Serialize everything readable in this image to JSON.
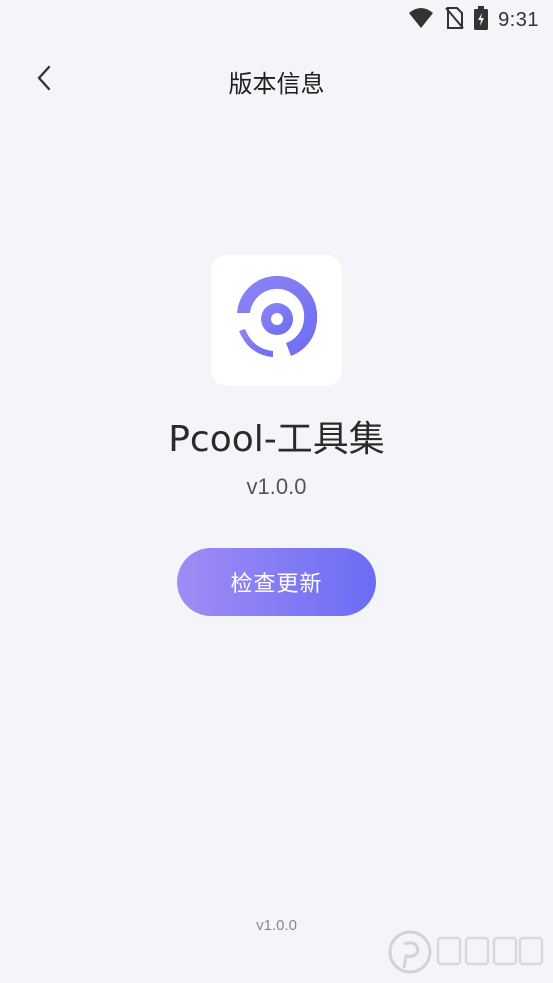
{
  "status_bar": {
    "time": "9:31",
    "icons": [
      "wifi-icon",
      "no-sim-icon",
      "battery-charging-icon"
    ]
  },
  "nav": {
    "back_icon": "chevron-left-icon",
    "title": "版本信息"
  },
  "app": {
    "logo_icon": "app-logo-icon",
    "name": "Pcool-工具集",
    "version": "v1.0.0"
  },
  "actions": {
    "check_update_label": "检查更新"
  },
  "footer": {
    "version": "v1.0.0"
  },
  "colors": {
    "background": "#f4f5f9",
    "accent_start": "#a08cf5",
    "accent_end": "#6b6cf4",
    "logo_purple": "#7b75f0"
  }
}
